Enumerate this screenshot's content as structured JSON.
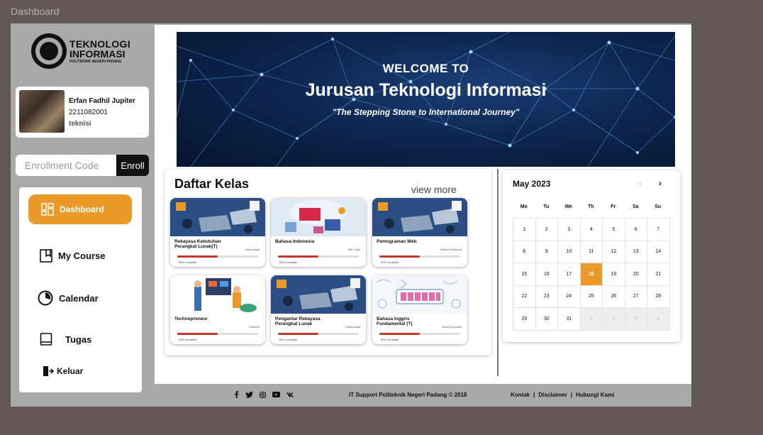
{
  "window": {
    "title": "Dashboard"
  },
  "logo": {
    "line1": "TEKNOLOGI",
    "line2": "INFORMASI",
    "line3": "POLITEKNIK NEGERI PADANG"
  },
  "profile": {
    "name": "Erfan Fadhil Jupiter",
    "nim": "2211082001",
    "role": "teknisi",
    "menu": "..."
  },
  "enroll": {
    "placeholder": "Enrollment Code",
    "button": "Enroll"
  },
  "nav": [
    {
      "label": "Dashboard",
      "icon": "dashboard-grid-icon",
      "active": true
    },
    {
      "label": "My Course",
      "icon": "book-icon"
    },
    {
      "label": "Calendar",
      "icon": "clock-icon"
    },
    {
      "label": "Tugas",
      "icon": "notebook-icon"
    },
    {
      "label": "Keluar",
      "icon": "logout-icon"
    }
  ],
  "banner": {
    "welcome": "WELCOME TO",
    "title": "Jurusan Teknologi Informasi",
    "subtitle": "\"The Stepping Stone to International Journey\""
  },
  "kelas": {
    "title": "Daftar Kelas",
    "view_more": "view more",
    "courses": [
      {
        "title": "Rekayasa Kebutuhan Perangkat Lunak(T)",
        "teacher": "Yulherniwati",
        "progress": "50% complete",
        "fill": 0.5,
        "image": "workspace-laptops"
      },
      {
        "title": "Bahasa Indonesia",
        "teacher": "Titik Fujita",
        "progress": "50% complete",
        "fill": 0.5,
        "image": "bahasa-indonesia-books"
      },
      {
        "title": "Pemograman Web",
        "teacher": "Ardhon Rahkmat",
        "progress": "50% complete",
        "fill": 0.5,
        "image": "workspace-laptops"
      },
      {
        "title": "Technopreneur",
        "teacher": "Gusteriz",
        "progress": "50% complete",
        "fill": 0.5,
        "image": "technopreneur-team"
      },
      {
        "title": "Pengantar Rekayasa Perangkat Lunak",
        "teacher": "Yulherniwati",
        "progress": "50% complete",
        "fill": 0.5,
        "image": "workspace-laptops"
      },
      {
        "title": "Bahasa Inggris Fundamental (T)",
        "teacher": "Silvia Djonnaidi",
        "progress": "50% complete",
        "fill": 0.5,
        "image": "english-doodle"
      }
    ]
  },
  "calendar": {
    "month": "May 2023",
    "prev": "‹",
    "next": "›",
    "day_names": [
      "Mo",
      "Tu",
      "We",
      "Th",
      "Fr",
      "Sa",
      "Su"
    ],
    "days": [
      {
        "d": "1"
      },
      {
        "d": "2"
      },
      {
        "d": "3"
      },
      {
        "d": "4"
      },
      {
        "d": "5"
      },
      {
        "d": "6"
      },
      {
        "d": "7"
      },
      {
        "d": "8"
      },
      {
        "d": "9"
      },
      {
        "d": "10"
      },
      {
        "d": "11"
      },
      {
        "d": "12"
      },
      {
        "d": "13"
      },
      {
        "d": "14"
      },
      {
        "d": "15"
      },
      {
        "d": "16"
      },
      {
        "d": "17"
      },
      {
        "d": "18",
        "today": true
      },
      {
        "d": "19"
      },
      {
        "d": "20"
      },
      {
        "d": "21"
      },
      {
        "d": "22"
      },
      {
        "d": "23"
      },
      {
        "d": "24"
      },
      {
        "d": "25"
      },
      {
        "d": "26"
      },
      {
        "d": "27"
      },
      {
        "d": "28"
      },
      {
        "d": "29"
      },
      {
        "d": "30"
      },
      {
        "d": "31"
      },
      {
        "d": "1",
        "muted": true
      },
      {
        "d": "2",
        "muted": true
      },
      {
        "d": "3",
        "muted": true
      },
      {
        "d": "4",
        "muted": true
      }
    ]
  },
  "footer": {
    "social": [
      "facebook-icon",
      "twitter-icon",
      "instagram-icon",
      "youtube-icon",
      "vk-icon"
    ],
    "copyright": "IT Support Politeknik Negeri Padang © 2018",
    "links": [
      "Kontak",
      "|",
      "Disclaimer",
      "|",
      "Hubungi Kami"
    ]
  },
  "colors": {
    "accent": "#e99a28",
    "background": "#625656",
    "frame": "#a9a9a9",
    "progress": "#c0392b"
  }
}
